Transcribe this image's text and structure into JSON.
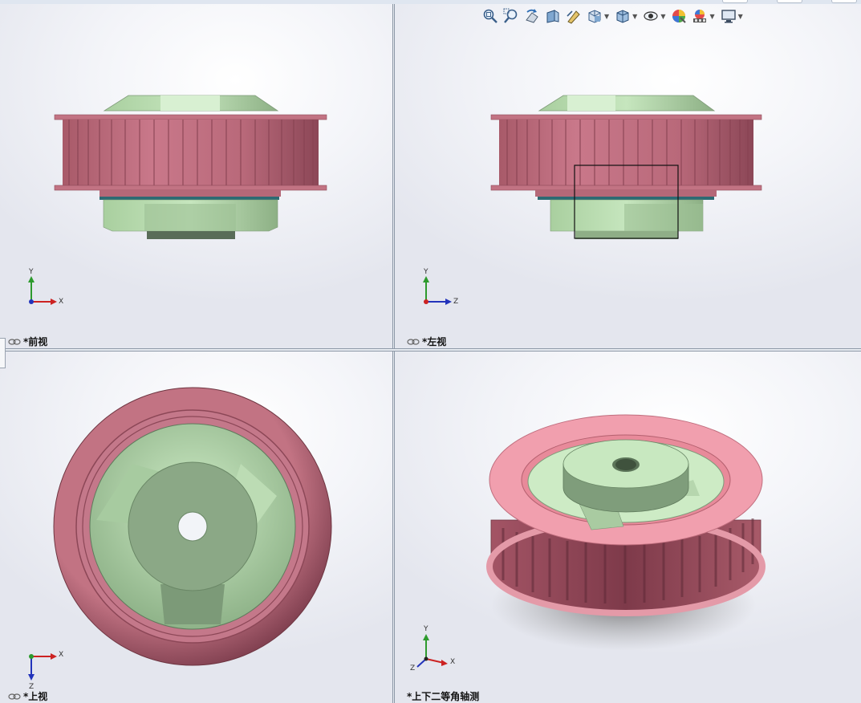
{
  "viewports": {
    "front": {
      "label": "*前视",
      "axes": {
        "vertical": "Y",
        "horizontal": "X"
      }
    },
    "left": {
      "label": "*左视",
      "axes": {
        "vertical": "Y",
        "horizontal": "Z"
      }
    },
    "top": {
      "label": "*上视",
      "axes": {
        "horizontal": "X",
        "vertical": "Z"
      }
    },
    "iso": {
      "label": "*上下二等角轴测",
      "axes": {
        "vertical": "Y",
        "horizontal": "X",
        "depth": "Z"
      }
    }
  },
  "colors": {
    "pulley_pink": "#c96f7f",
    "pulley_dark": "#8e4a58",
    "hub_green": "#b9dcb3",
    "hub_dark": "#7f9e7b",
    "washer_teal": "#2d6a73",
    "background": "#e8eaf0"
  },
  "toolbar": {
    "icons": [
      "zoom-to-fit-icon",
      "zoom-to-area-icon",
      "previous-view-icon",
      "section-view-icon",
      "dynamic-annotation-icon",
      "view-orientation-icon",
      "display-style-icon",
      "hide-show-items-icon",
      "edit-appearance-icon",
      "apply-scene-icon",
      "view-settings-icon"
    ]
  }
}
